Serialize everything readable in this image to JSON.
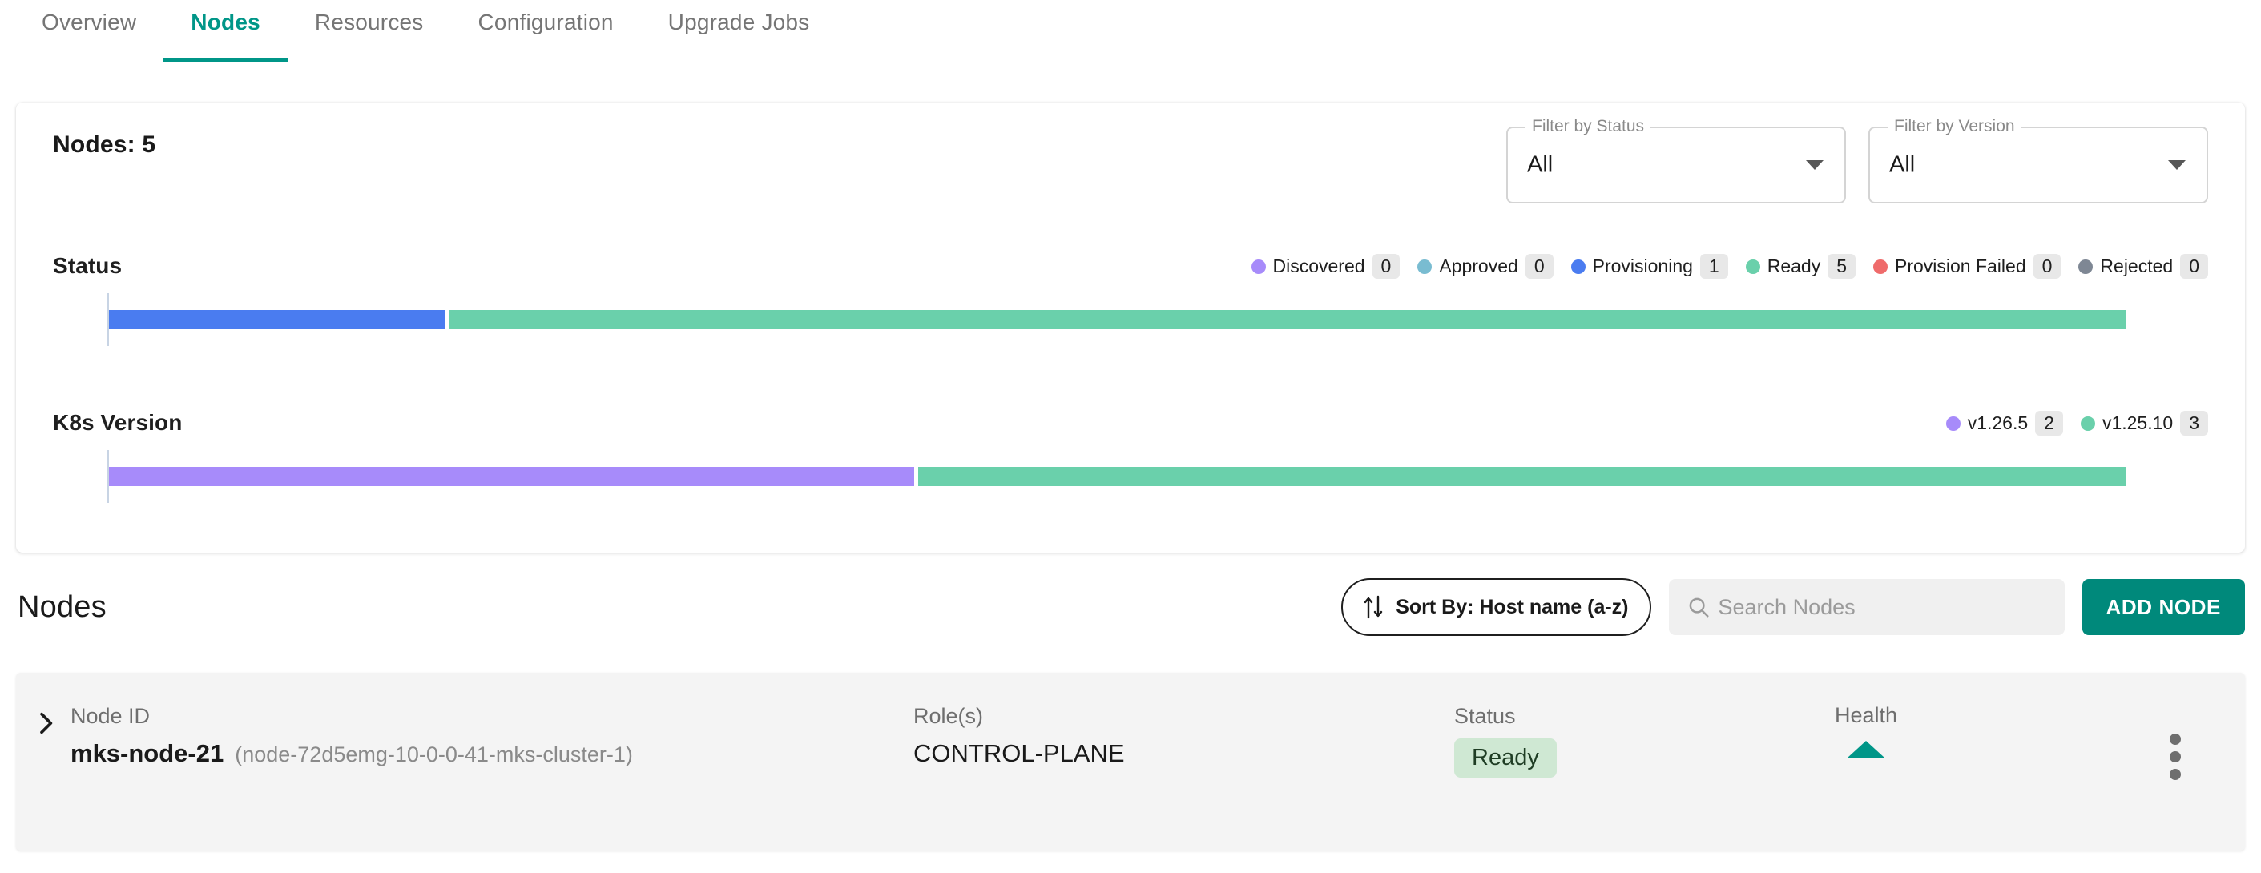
{
  "tabs": [
    {
      "label": "Overview",
      "active": false
    },
    {
      "label": "Nodes",
      "active": true
    },
    {
      "label": "Resources",
      "active": false
    },
    {
      "label": "Configuration",
      "active": false
    },
    {
      "label": "Upgrade Jobs",
      "active": false
    }
  ],
  "summary": {
    "nodes_count_label": "Nodes: 5",
    "filters": [
      {
        "label": "Filter by Status",
        "value": "All"
      },
      {
        "label": "Filter by Version",
        "value": "All"
      }
    ]
  },
  "chart_data": [
    {
      "type": "bar",
      "title": "Status",
      "orientation": "horizontal-stacked",
      "categories": [
        "Discovered",
        "Approved",
        "Provisioning",
        "Ready",
        "Provision Failed",
        "Rejected"
      ],
      "values": [
        0,
        0,
        1,
        5,
        0,
        0
      ],
      "colors": [
        "#a78bfa",
        "#79bcd1",
        "#4a7cf0",
        "#6ad0ab",
        "#ef6b6b",
        "#7e8794"
      ],
      "legend_position": "top-right",
      "grid": false,
      "total": 6
    },
    {
      "type": "bar",
      "title": "K8s Version",
      "orientation": "horizontal-stacked",
      "categories": [
        "v1.26.5",
        "v1.25.10"
      ],
      "values": [
        2,
        3
      ],
      "colors": [
        "#a78bfa",
        "#6ad0ab"
      ],
      "legend_position": "top-right",
      "grid": false,
      "total": 5
    }
  ],
  "nodes_section": {
    "title": "Nodes",
    "sort_label": "Sort By: Host name (a-z)",
    "search_placeholder": "Search Nodes",
    "search_value": "",
    "add_button_label": "ADD NODE",
    "columns": {
      "node_id": "Node ID",
      "roles": "Role(s)",
      "status": "Status",
      "health": "Health"
    },
    "rows": [
      {
        "name": "mks-node-21",
        "sub": "(node-72d5emg-10-0-0-41-mks-cluster-1)",
        "role": "CONTROL-PLANE",
        "status": "Ready",
        "health": "healthy-up-arrow"
      }
    ]
  },
  "colors": {
    "accent": "#009688",
    "add_button": "#00897b",
    "status_pill_bg": "#cfe8d3",
    "row_bg": "#f4f4f4"
  }
}
